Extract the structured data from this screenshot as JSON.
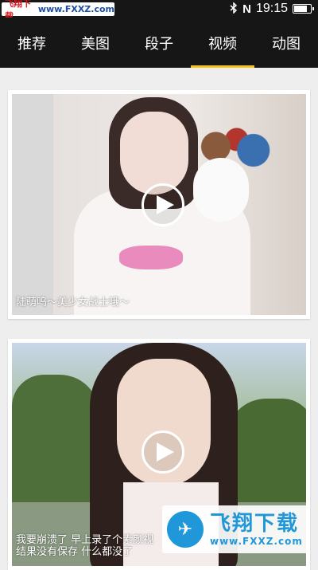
{
  "status_bar": {
    "watermark_prefix": "飞翔下载",
    "watermark_url": "www.FXXZ.com",
    "bluetooth_icon": "bluetooth-icon",
    "nfc_label": "N",
    "time": "19:15",
    "battery_level": 0.85
  },
  "tabs": [
    {
      "label": "推荐",
      "active": false
    },
    {
      "label": "美图",
      "active": false
    },
    {
      "label": "段子",
      "active": false
    },
    {
      "label": "视频",
      "active": true
    },
    {
      "label": "动图",
      "active": false
    }
  ],
  "videos": [
    {
      "caption": "陆萌呜～美少女战士哦～",
      "play_icon": "play-icon"
    },
    {
      "caption_line1": "我要崩溃了  早上录了个素颜视",
      "caption_line2": "结果没有保存 什么都没了",
      "play_icon": "play-icon"
    }
  ],
  "watermark_bottom": {
    "name": "飞翔下载",
    "url": "www.FXXZ.com"
  },
  "colors": {
    "header_bg": "#161616",
    "active_tab_indicator": "#f3c51b",
    "background": "#eeeeee",
    "watermark_blue": "#1f97d9"
  }
}
